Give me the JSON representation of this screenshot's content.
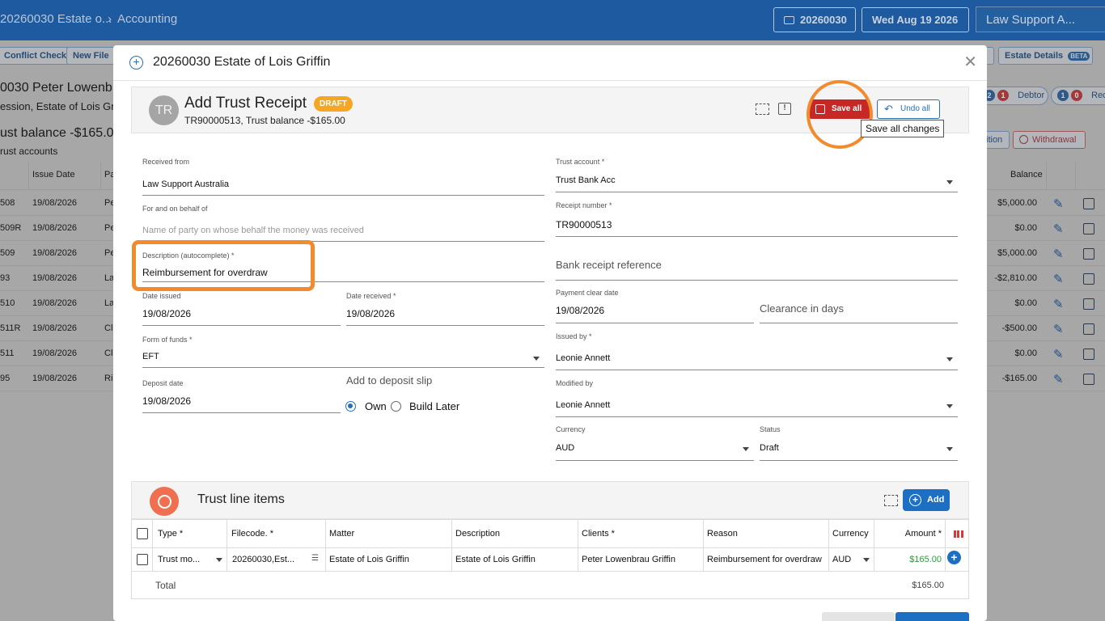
{
  "topbar": {
    "crumb_file": "20260030 Estate o...",
    "crumb_sep": "›",
    "crumb_section": "Accounting",
    "matter_pill": "20260030",
    "date_pill": "Wed Aug 19 2026",
    "org": "Law Support A..."
  },
  "background": {
    "buttons": [
      "Conflict Check",
      "New File",
      "Estate Details"
    ],
    "beta": "BETA",
    "matter_title": "0030 Peter Lowenb",
    "matter_sub": "ession, Estate of Lois Grif",
    "trust_balance": "ust balance -$165.00",
    "trust_accounts": "rust accounts",
    "col_issue_date": "Issue Date",
    "col_pa": "Pa",
    "col_balance": "Balance",
    "debtor_count_a": "2",
    "debtor_count_b": "1",
    "debtor_label": "Debtor",
    "rec_count_a": "1",
    "rec_count_b": "0",
    "rec_label": "Rece",
    "position_label": "ition",
    "withdrawal_label": "Withdrawal",
    "rows": [
      {
        "ref": "508",
        "date": "19/08/2026",
        "p": "Pe",
        "bal": "$5,000.00"
      },
      {
        "ref": "509R",
        "date": "19/08/2026",
        "p": "Pe",
        "bal": "$0.00"
      },
      {
        "ref": "509",
        "date": "19/08/2026",
        "p": "Pe",
        "bal": "$5,000.00"
      },
      {
        "ref": "93",
        "date": "19/08/2026",
        "p": "La",
        "bal": "-$2,810.00"
      },
      {
        "ref": "510",
        "date": "19/08/2026",
        "p": "La",
        "bal": "$0.00"
      },
      {
        "ref": "511R",
        "date": "19/08/2026",
        "p": "Cl",
        "bal": "-$500.00"
      },
      {
        "ref": "511",
        "date": "19/08/2026",
        "p": "Cl",
        "bal": "$0.00"
      },
      {
        "ref": "95",
        "date": "19/08/2026",
        "p": "Ri",
        "bal": "-$165.00"
      }
    ]
  },
  "modal": {
    "title": "20260030 Estate of Lois Griffin",
    "avatar": "TR",
    "heading": "Add Trust Receipt",
    "status_badge": "DRAFT",
    "meta": "TR90000513, Trust balance -$165.00",
    "save_all": "Save all",
    "undo_all": "Undo all",
    "tooltip": "Save all changes"
  },
  "form": {
    "received_from_label": "Received from",
    "received_from": "Law Support Australia",
    "on_behalf_label": "For and on behalf of",
    "on_behalf_placeholder": "Name of party on whose behalf the money was received",
    "description_label": "Description (autocomplete) *",
    "description": "Reimbursement for overdraw",
    "date_issued_label": "Date issued",
    "date_issued": "19/08/2026",
    "date_received_label": "Date received *",
    "date_received": "19/08/2026",
    "form_of_funds_label": "Form of funds *",
    "form_of_funds": "EFT",
    "deposit_date_label": "Deposit date",
    "deposit_date": "19/08/2026",
    "deposit_slip_label": "Add to deposit slip",
    "radio_own": "Own",
    "radio_build_later": "Build Later",
    "trust_account_label": "Trust account *",
    "trust_account": "Trust Bank Acc",
    "receipt_number_label": "Receipt number *",
    "receipt_number": "TR90000513",
    "bank_ref_placeholder": "Bank receipt reference",
    "payment_clear_label": "Payment clear date",
    "payment_clear": "19/08/2026",
    "clearance_placeholder": "Clearance in days",
    "issued_by_label": "Issued by *",
    "issued_by": "Leonie Annett",
    "modified_by_label": "Modified by",
    "modified_by": "Leonie Annett",
    "currency_label": "Currency",
    "currency": "AUD",
    "status_label": "Status",
    "status": "Draft"
  },
  "line_items": {
    "title": "Trust line items",
    "add": "Add",
    "columns": [
      "Type *",
      "Filecode. *",
      "Matter",
      "Description",
      "Clients *",
      "Reason",
      "Currency",
      "Amount *"
    ],
    "row": {
      "type": "Trust mo...",
      "filecode": "20260030,Est...",
      "matter": "Estate of Lois Griffin",
      "description": "Estate of Lois Griffin",
      "clients": "Peter Lowenbrau Griffin",
      "reason": "Reimbursement for overdraw",
      "currency": "AUD",
      "amount": "$165.00"
    },
    "total_label": "Total",
    "total": "$165.00"
  },
  "colors": {
    "brand": "#1d5aa0",
    "save": "#c62828",
    "accent": "#1c6fc3",
    "highlight": "#f28a2e",
    "amount": "#2e9a3a"
  }
}
